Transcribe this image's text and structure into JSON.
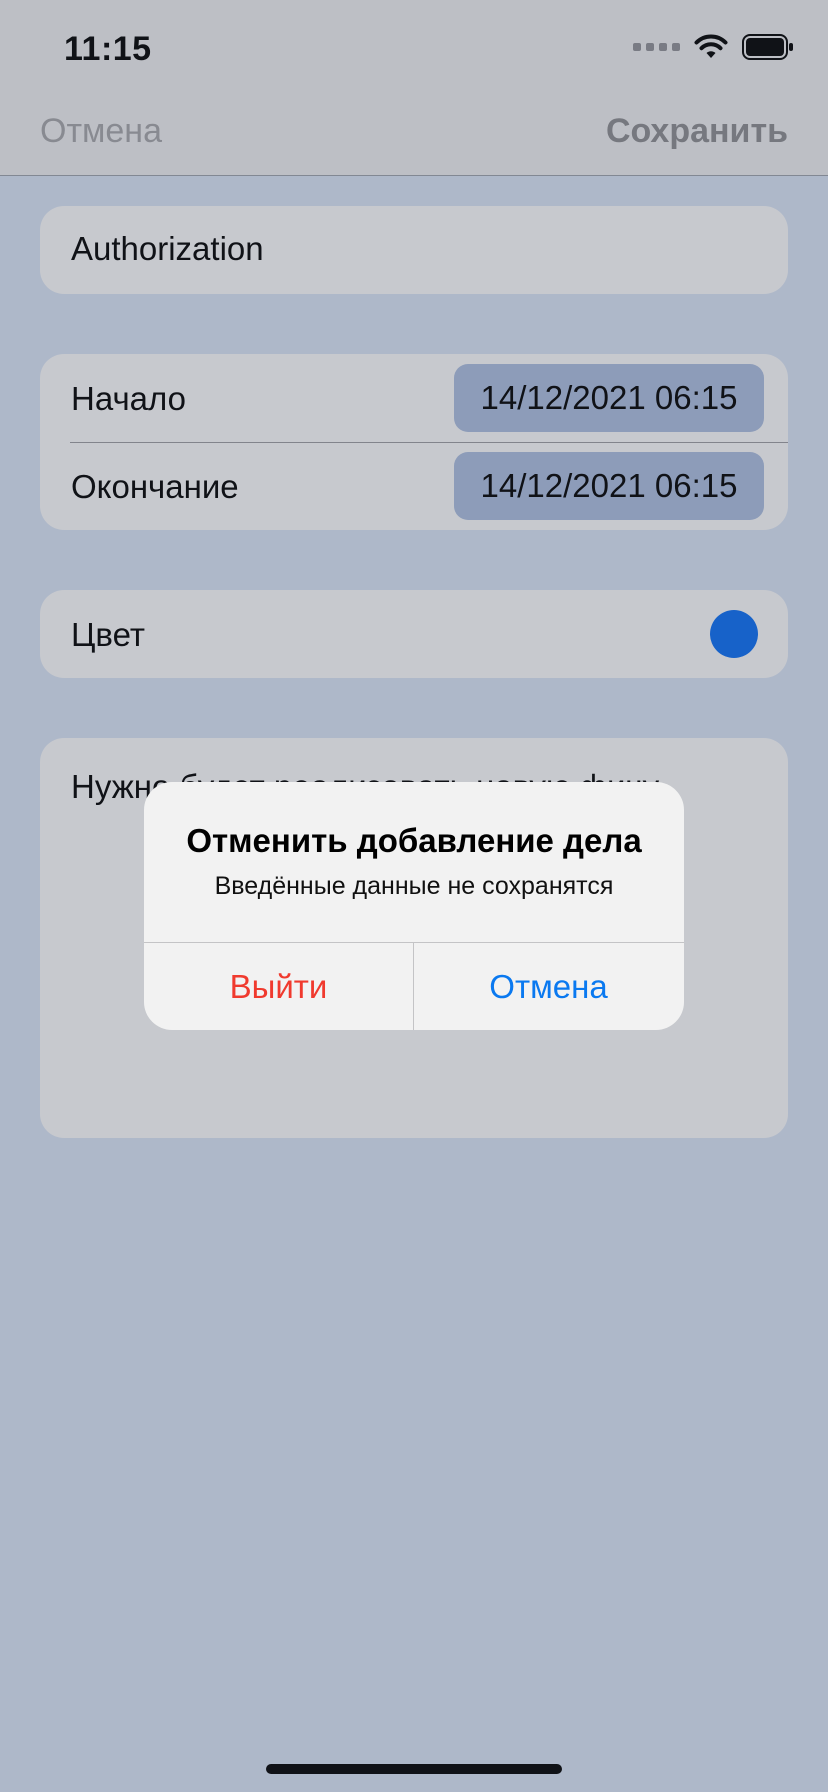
{
  "status_bar": {
    "time": "11:15"
  },
  "nav": {
    "cancel_label": "Отмена",
    "save_label": "Сохранить"
  },
  "task": {
    "title": "Authorization"
  },
  "dates": [
    {
      "label": "Начало",
      "value": "14/12/2021 06:15"
    },
    {
      "label": "Окончание",
      "value": "14/12/2021 06:15"
    }
  ],
  "color_row": {
    "label": "Цвет",
    "color": "#0a6cf0"
  },
  "notes": {
    "text": "Нужно будет реализовать новую фичу"
  },
  "alert": {
    "title": "Отменить добавление дела",
    "message": "Введённые данные не сохранятся",
    "exit_label": "Выйти",
    "cancel_label": "Отмена"
  },
  "colors": {
    "destructive": "#f03a2e",
    "accent": "#0a79f0"
  }
}
